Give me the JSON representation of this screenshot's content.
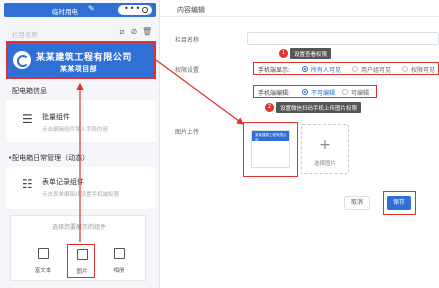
{
  "phone": {
    "title": "临时用电",
    "edit_icon": "pencil-icon",
    "column_placeholder": "栏目名称",
    "banner": {
      "company": "某某建筑工程有限公司",
      "project": "某某项目部"
    },
    "section1": "配电箱信息",
    "section2": "•配电箱日常管理（动态）",
    "cards": [
      {
        "icon": "list-icon",
        "title": "批量组件",
        "subtitle": "点击编辑组件导入字段内容"
      },
      {
        "icon": "form-icon",
        "title": "表单记录组件",
        "subtitle": "点击表单编辑并设置手机端权限"
      }
    ],
    "choose": {
      "title": "选择您要展示的组件",
      "items": [
        {
          "icon": "document-icon",
          "label": "富文本"
        },
        {
          "icon": "image-icon",
          "label": "图片"
        },
        {
          "icon": "album-icon",
          "label": "相册"
        }
      ]
    }
  },
  "editor": {
    "title": "内容编辑",
    "fields": {
      "name_label": "栏目名称",
      "perm_label": "权限设置",
      "image_label": "图片上传"
    },
    "perm": {
      "display_label": "手机端显示:",
      "display_options": [
        "所有人可见",
        "用户组可见",
        "权限可见"
      ],
      "edit_label": "手机端编辑:",
      "edit_options": [
        "不可编辑",
        "可编辑"
      ]
    },
    "tips": [
      {
        "num": "1",
        "text": "设置查看权限"
      },
      {
        "num": "2",
        "text": "设置微信扫码手机上传图片权限"
      }
    ],
    "thumb_text": "某某建筑工程有限公司",
    "upload_label": "选择图片",
    "upload_plus": "+",
    "cancel": "取消",
    "save": "保存"
  },
  "colors": {
    "primary": "#2f6fd6",
    "highlight": "#e03030"
  }
}
